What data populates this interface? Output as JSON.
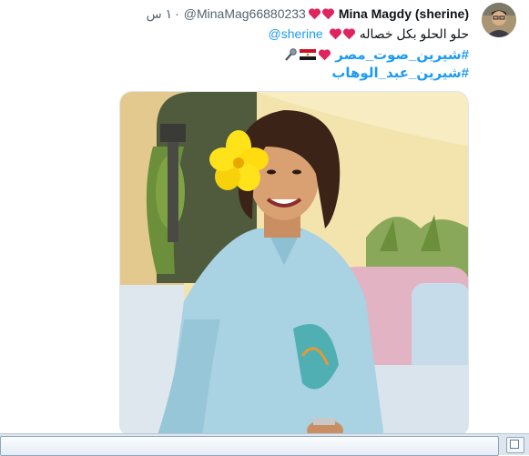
{
  "tweet": {
    "author_name": "Mina Magdy (sherine)",
    "author_hearts": [
      "red-heart-icon",
      "red-heart-icon"
    ],
    "handle": "@MinaMag66880233",
    "separator": "·",
    "time": "١ س",
    "body_text": "حلو الحلو بكل خصاله",
    "body_hearts": [
      "red-heart-icon",
      "red-heart-icon"
    ],
    "mention": "@sherine",
    "hashtag_1": "#شيرين_صوت_مصر",
    "hashtag_1_emojis": [
      "microphone-icon",
      "egypt-flag-icon",
      "red-heart-icon"
    ],
    "hashtag_2": "#شيرين_عبد_الوهاب",
    "media_alt": "photo"
  },
  "colors": {
    "link": "#1d9bf0",
    "text": "#0f1419",
    "muted": "#536471",
    "heart": "#e0245e"
  }
}
